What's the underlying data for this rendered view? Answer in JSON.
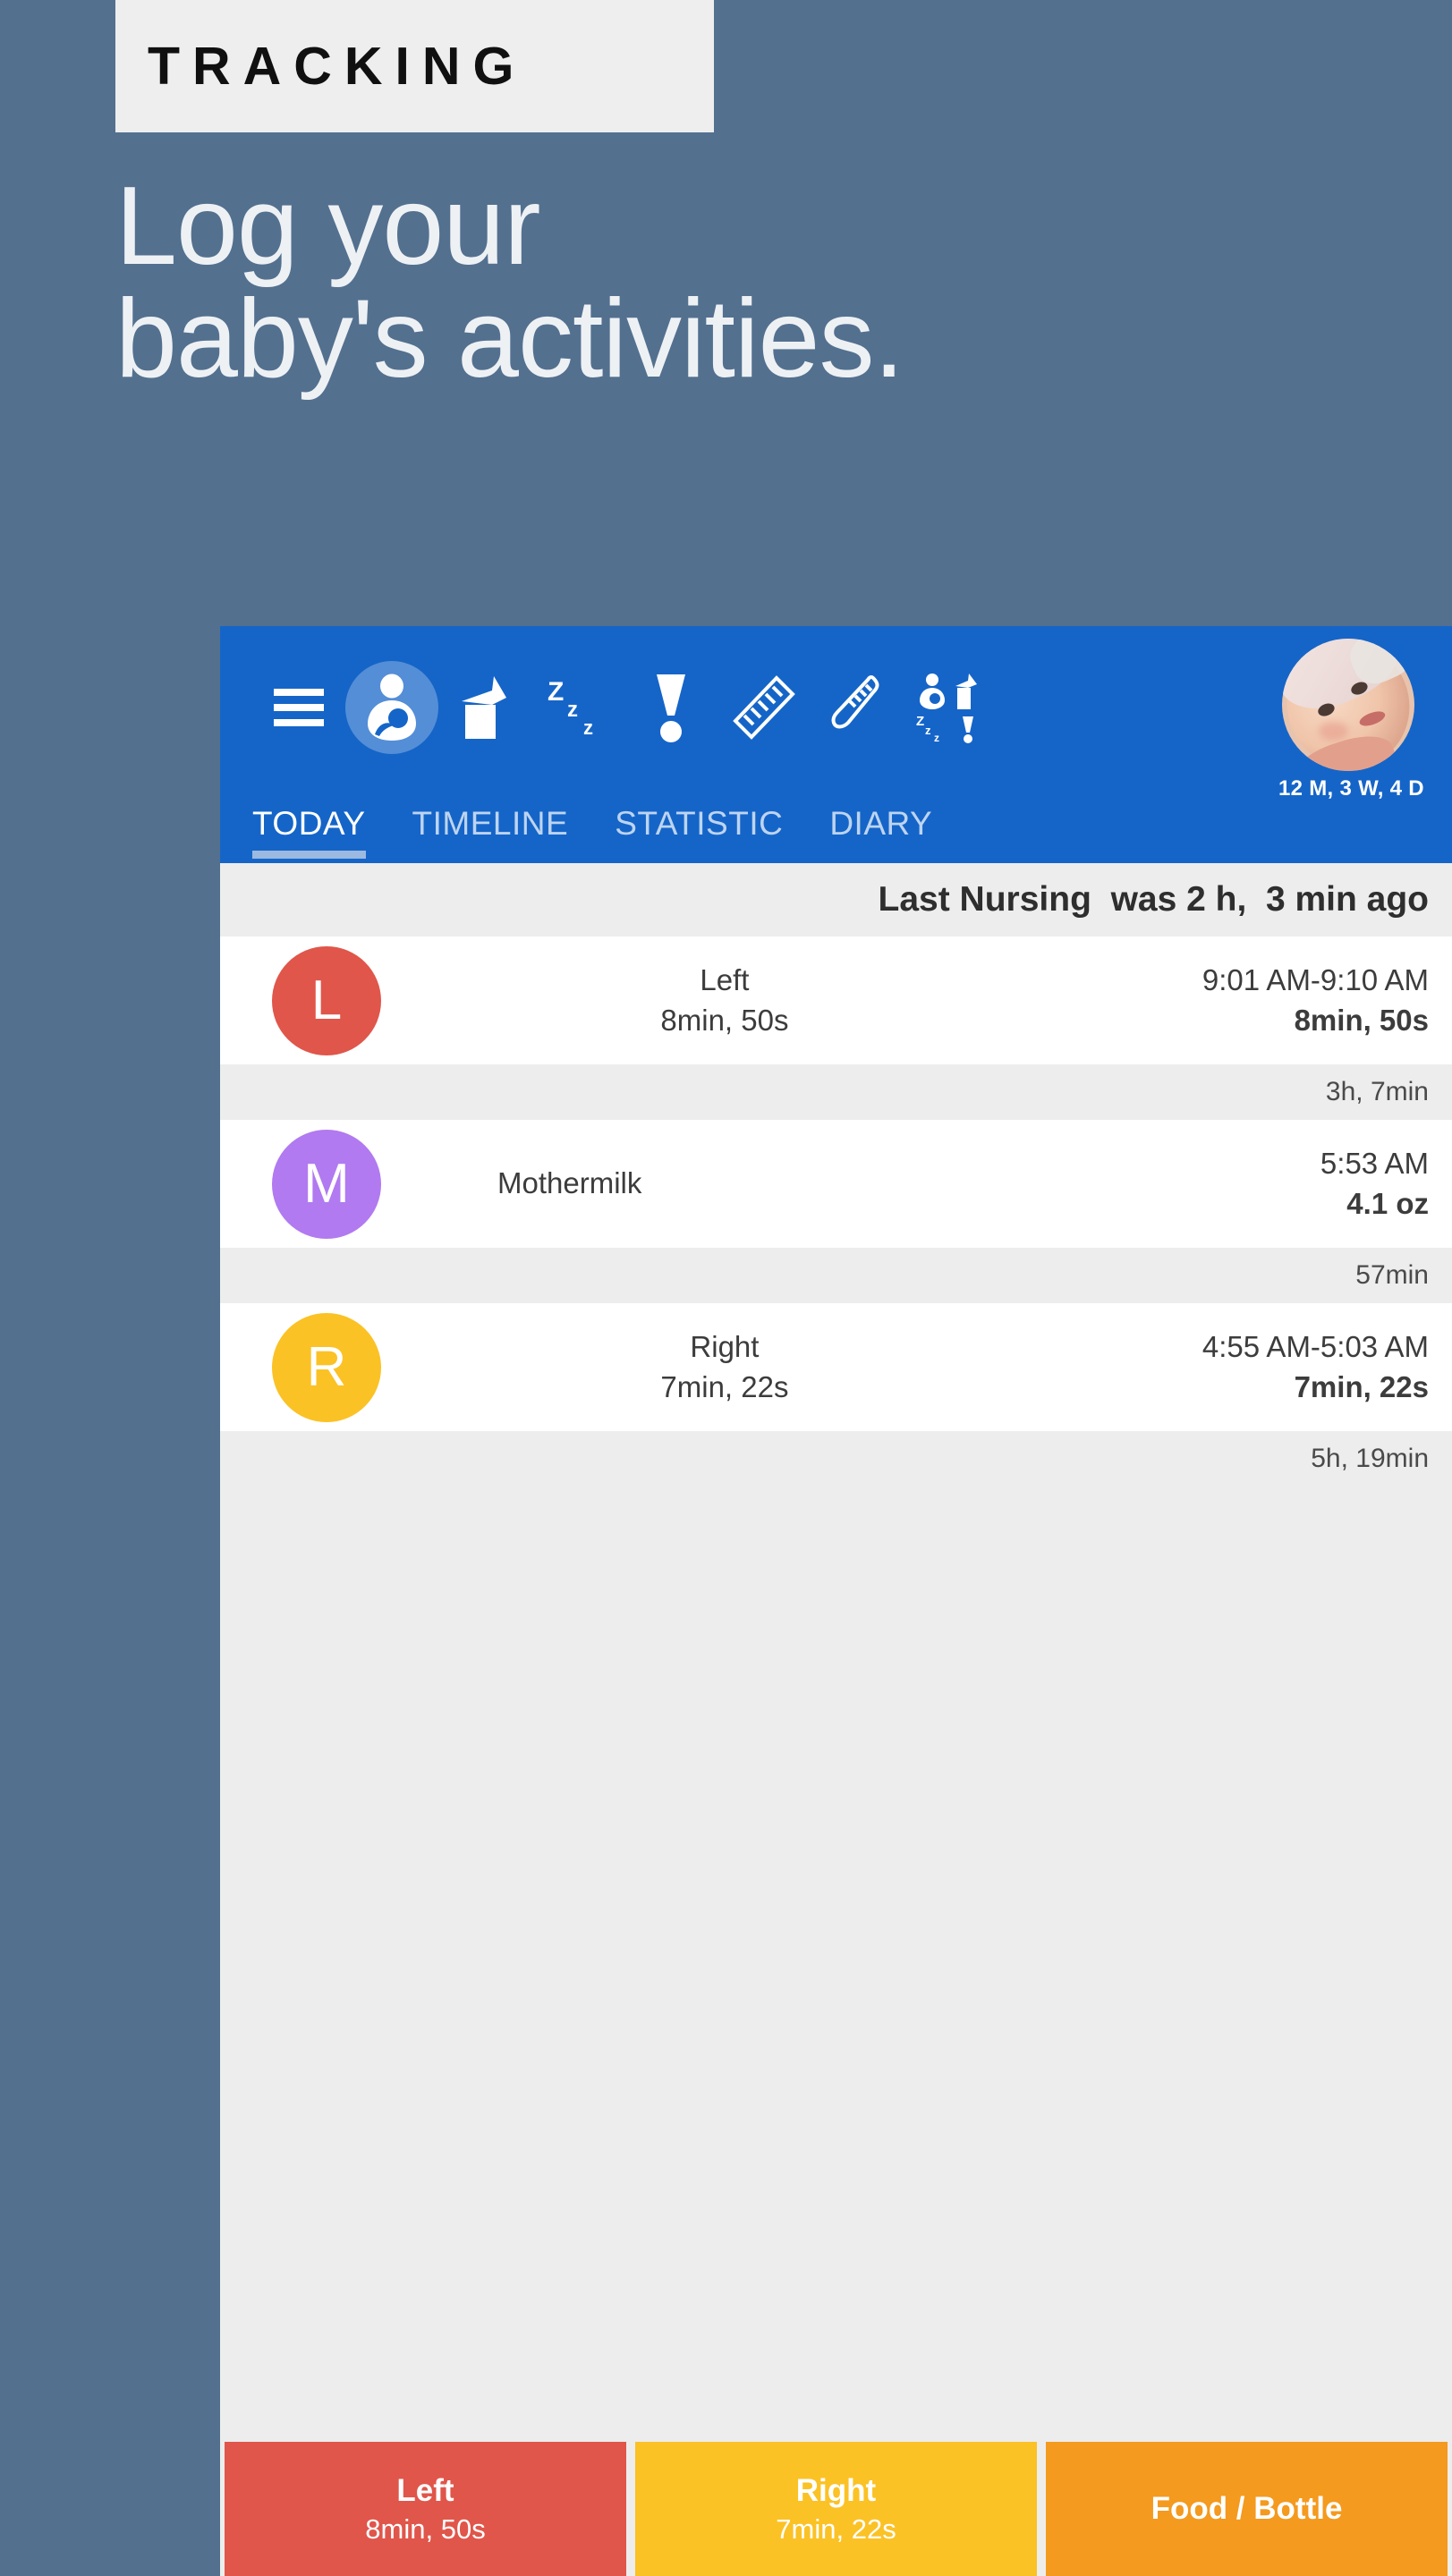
{
  "promo": {
    "badge": "TRACKING",
    "title": "Log your\nbaby's activities.",
    "bg_color": "#53708f",
    "badge_bg": "#eeeeee"
  },
  "appbar": {
    "bg_color": "#1565c8",
    "icons": [
      {
        "name": "menu-icon",
        "label": "Menu"
      },
      {
        "name": "nursing-icon",
        "label": "Nursing",
        "active": true
      },
      {
        "name": "pump-icon",
        "label": "Pumping"
      },
      {
        "name": "sleep-icon",
        "label": "Sleep",
        "glyph": "Zzz"
      },
      {
        "name": "diaper-icon",
        "label": "Diaper"
      },
      {
        "name": "ruler-icon",
        "label": "Measurements"
      },
      {
        "name": "thermometer-icon",
        "label": "Temperature"
      },
      {
        "name": "other-icon",
        "label": "Other"
      }
    ],
    "avatar": {
      "name": "baby-avatar",
      "age": "12 M, 3 W, 4 D"
    }
  },
  "tabs": [
    {
      "label": "TODAY",
      "active": true
    },
    {
      "label": "TIMELINE",
      "active": false
    },
    {
      "label": "STATISTIC",
      "active": false
    },
    {
      "label": "DIARY",
      "active": false
    }
  ],
  "status": {
    "last_nursing": "Last Nursing  was 2 h,  3 min ago"
  },
  "entries": [
    {
      "badge_letter": "L",
      "badge_color": "#e0564a",
      "side": "Left",
      "duration": "8min, 50s",
      "time_range": "9:01 AM-9:10 AM",
      "amount": "8min, 50s",
      "align": "center"
    },
    {
      "badge_letter": "M",
      "badge_color": "#b17af0",
      "side": "Mothermilk",
      "duration": "",
      "time_range": "5:53 AM",
      "amount": "4.1 oz",
      "align": "left"
    },
    {
      "badge_letter": "R",
      "badge_color": "#fbc226",
      "side": "Right",
      "duration": "7min, 22s",
      "time_range": "4:55 AM-5:03 AM",
      "amount": "7min, 22s",
      "align": "center"
    }
  ],
  "gaps": [
    "3h, 7min",
    "57min",
    "5h, 19min"
  ],
  "actions": [
    {
      "title": "Left",
      "sub": "8min, 50s",
      "color": "#e0564a"
    },
    {
      "title": "Right",
      "sub": "7min, 22s",
      "color": "#fbc226"
    },
    {
      "title": "Food / Bottle",
      "sub": "",
      "color": "#f49a1e"
    }
  ]
}
